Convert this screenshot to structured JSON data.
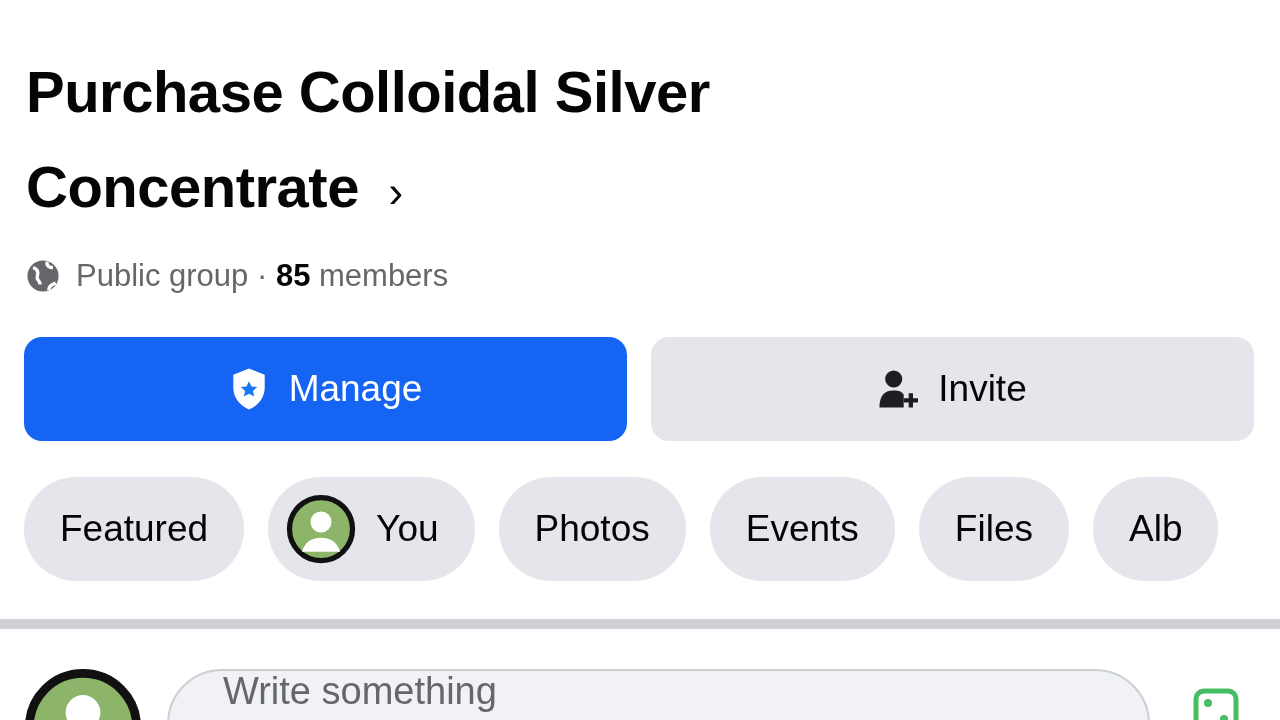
{
  "group": {
    "title": "Purchase Colloidal Silver Concentrate",
    "chevron": "›",
    "privacy": "Public group",
    "separator": "·",
    "member_count": "85",
    "member_label": "members"
  },
  "actions": [
    {
      "kind": "primary",
      "label": "Manage"
    },
    {
      "kind": "secondary",
      "label": "Invite"
    }
  ],
  "chips": [
    {
      "label": "Featured",
      "kind": "text"
    },
    {
      "label": "You",
      "kind": "avatar"
    },
    {
      "label": "Photos",
      "kind": "text"
    },
    {
      "label": "Events",
      "kind": "text"
    },
    {
      "label": "Files",
      "kind": "text"
    },
    {
      "label": "Alb",
      "kind": "text"
    }
  ],
  "composer": {
    "placeholder": "Write something"
  }
}
